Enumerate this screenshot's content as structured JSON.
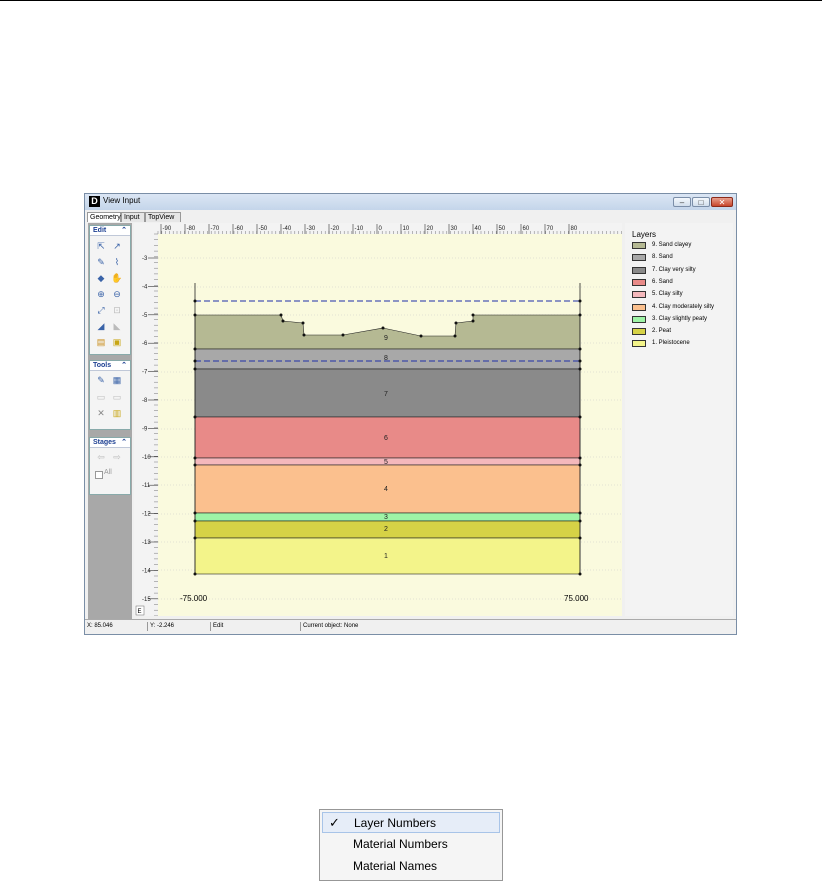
{
  "window": {
    "title": "View Input",
    "app_icon_letter": "D",
    "controls": [
      "minimize",
      "maximize",
      "close"
    ]
  },
  "tabs": [
    {
      "label": "Geometry",
      "active": true
    },
    {
      "label": "Input",
      "active": false
    },
    {
      "label": "TopView",
      "active": false
    }
  ],
  "left_panel": {
    "edit": {
      "title": "Edit",
      "icons": [
        "select-arrow-icon",
        "select-region-icon",
        "add-point-icon",
        "add-polyline-icon",
        "add-layer-icon",
        "pan-hand-icon",
        "zoom-in-icon",
        "zoom-out-icon",
        "zoom-limits-icon",
        "zoom-window-icon",
        "measure-icon",
        "ruler-icon",
        "import-icon",
        "export-icon"
      ]
    },
    "tools": {
      "title": "Tools",
      "icons": [
        "check-geometry-icon",
        "convert-icon",
        "undo-icon",
        "redo-icon",
        "delete-icon",
        "properties-icon"
      ]
    },
    "stages": {
      "title": "Stages",
      "icons": [
        "prev-stage-icon",
        "next-stage-icon"
      ],
      "all_label": "All"
    }
  },
  "ruler": {
    "x_ticks": [
      "-90",
      "-80",
      "-70",
      "-60",
      "-50",
      "-40",
      "-30",
      "-20",
      "-10",
      "0",
      "10",
      "20",
      "30",
      "40",
      "50",
      "60",
      "70",
      "80"
    ],
    "y_ticks": [
      "-3",
      "-4",
      "-5",
      "-6",
      "-7",
      "-8",
      "-9",
      "-10",
      "-11",
      "-12",
      "-13",
      "-14",
      "-15"
    ],
    "corner_label": "E"
  },
  "geometry": {
    "left_label": "-75.000",
    "right_label": "75.000",
    "layer_numbers": [
      "9",
      "8",
      "7",
      "6",
      "5",
      "4",
      "3",
      "2",
      "1"
    ]
  },
  "legend": {
    "title": "Layers",
    "items": [
      {
        "label": "9. Sand clayey",
        "color": "#b5b993"
      },
      {
        "label": "8. Sand",
        "color": "#a8a8a8"
      },
      {
        "label": "7. Clay very silty",
        "color": "#8a8a8a"
      },
      {
        "label": "6. Sand",
        "color": "#e88a88"
      },
      {
        "label": "5. Clay silty",
        "color": "#f4b8bc"
      },
      {
        "label": "4. Clay moderately silty",
        "color": "#fbc08e"
      },
      {
        "label": "3. Clay slightly peaty",
        "color": "#9ef4a6"
      },
      {
        "label": "2. Peat",
        "color": "#d6d246"
      },
      {
        "label": "1. Pleistocene",
        "color": "#f3f48a"
      }
    ]
  },
  "statusbar": {
    "x": "X: 85.046",
    "y": "Y: -2.246",
    "mode": "Edit",
    "current": "Current object: None"
  },
  "context_menu": {
    "items": [
      {
        "label": "Layer Numbers",
        "checked": true,
        "check_glyph": "✓"
      },
      {
        "label": "Material Numbers",
        "checked": false
      },
      {
        "label": "Material Names",
        "checked": false
      }
    ]
  }
}
